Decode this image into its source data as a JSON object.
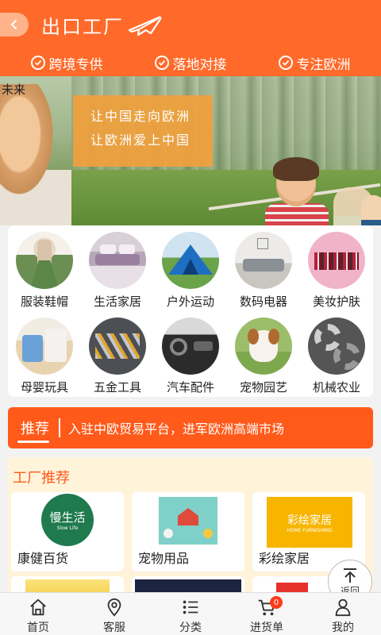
{
  "header": {
    "title": "出口工厂",
    "back_icon": "chevron-left-icon",
    "plane_icon": "airplane-icon",
    "color": "#ff6a2a"
  },
  "benefits": [
    {
      "label": "跨境专供",
      "icon": "check-circle-icon"
    },
    {
      "label": "落地对接",
      "icon": "check-circle-icon"
    },
    {
      "label": "专注欧洲",
      "icon": "check-circle-icon"
    }
  ],
  "banner": {
    "watermark": "未来",
    "slogan_line1": "让中国走向欧洲",
    "slogan_line2": "让欧洲爱上中国"
  },
  "categories": [
    {
      "label": "服装鞋帽",
      "image": "clothing"
    },
    {
      "label": "生活家居",
      "image": "home-bedding"
    },
    {
      "label": "户外运动",
      "image": "tent"
    },
    {
      "label": "数码电器",
      "image": "living-room"
    },
    {
      "label": "美妆护肤",
      "image": "lipsticks"
    },
    {
      "label": "母婴玩具",
      "image": "baby-items"
    },
    {
      "label": "五金工具",
      "image": "tools"
    },
    {
      "label": "汽车配件",
      "image": "car-interior"
    },
    {
      "label": "宠物园艺",
      "image": "puppy"
    },
    {
      "label": "机械农业",
      "image": "gears"
    }
  ],
  "ticker": {
    "tag": "推荐",
    "text": "入驻中欧贸易平台，进军欧洲高端市场",
    "color": "#ff5a1a"
  },
  "factory": {
    "title": "工厂推荐",
    "cards": [
      {
        "name": "康健百货",
        "logo_text": "慢生活",
        "logo_sub": "Slow Life"
      },
      {
        "name": "宠物用品",
        "logo_text": "",
        "logo_sub": ""
      },
      {
        "name": "彩绘家居",
        "logo_text": "彩绘家居",
        "logo_sub": "HOME FURNISHING"
      }
    ]
  },
  "to_top": {
    "label": "返回",
    "icon": "arrow-up-icon"
  },
  "nav": [
    {
      "label": "首页",
      "icon": "home-icon"
    },
    {
      "label": "客服",
      "icon": "location-pin-icon"
    },
    {
      "label": "分类",
      "icon": "list-icon"
    },
    {
      "label": "进货单",
      "icon": "cart-icon",
      "badge": "0"
    },
    {
      "label": "我的",
      "icon": "user-icon"
    }
  ]
}
